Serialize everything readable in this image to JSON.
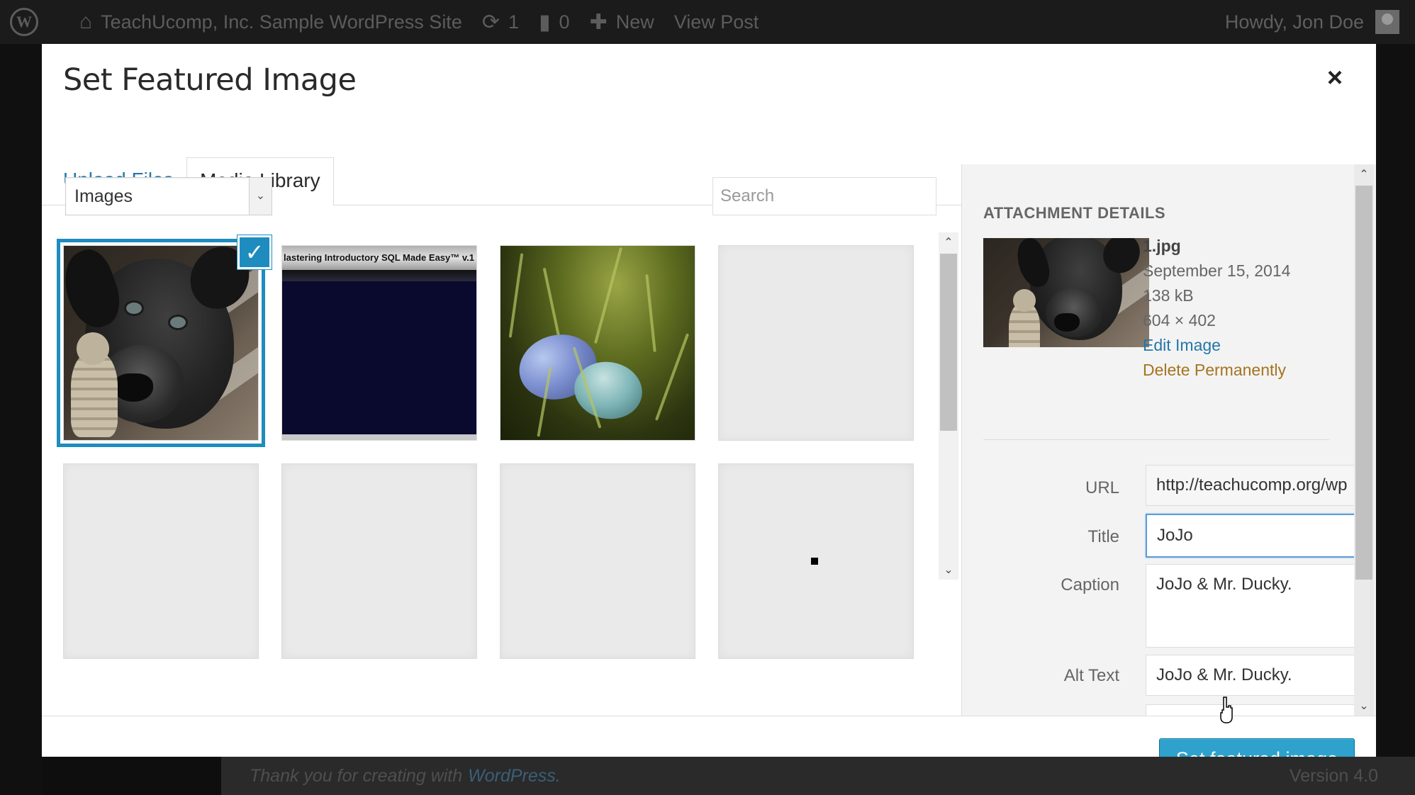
{
  "admin_bar": {
    "site_name": "TeachUcomp, Inc. Sample WordPress Site",
    "updates_count": "1",
    "comments_count": "0",
    "new_label": "New",
    "view_post_label": "View Post",
    "howdy": "Howdy, Jon Doe",
    "icons": [
      "wordpress-logo-icon",
      "home-icon",
      "updates-icon",
      "comment-icon",
      "plus-icon"
    ]
  },
  "modal": {
    "title": "Set Featured Image",
    "close_glyph": "×",
    "tabs": [
      {
        "label": "Upload Files",
        "active": false
      },
      {
        "label": "Media Library",
        "active": true
      }
    ],
    "filter": {
      "selected": "Images",
      "arrow_glyph": "⌄"
    },
    "search": {
      "placeholder": "Search"
    },
    "grid": {
      "items": [
        {
          "name": "dog-photo",
          "selected": true
        },
        {
          "name": "sql-banner",
          "selected": false,
          "caption": "lastering Introductory SQL Made Easy™ v.1"
        },
        {
          "name": "eggs-photo",
          "selected": false
        },
        {
          "name": "blank",
          "selected": false
        },
        {
          "name": "blank",
          "selected": false
        },
        {
          "name": "blank",
          "selected": false
        },
        {
          "name": "blank",
          "selected": false
        },
        {
          "name": "blank",
          "selected": false
        }
      ],
      "check_glyph": "✓"
    },
    "attachment_details": {
      "heading": "ATTACHMENT DETAILS",
      "filename": "1.jpg",
      "date": "September 15, 2014",
      "size": "138 kB",
      "dimensions": "604 × 402",
      "edit_link": "Edit Image",
      "delete_link": "Delete Permanently",
      "fields": {
        "url_label": "URL",
        "url_value": "http://teachucomp.org/wp",
        "title_label": "Title",
        "title_value": "JoJo",
        "caption_label": "Caption",
        "caption_value": "JoJo & Mr. Ducky.",
        "alt_label": "Alt Text",
        "alt_value": "JoJo & Mr. Ducky."
      }
    },
    "primary_button": "Set featured image"
  },
  "background_footer": {
    "thanks_text": "Thank you for creating with",
    "wp_link": "WordPress.",
    "version": "Version 4.0"
  },
  "colors": {
    "accent": "#2ea2cc",
    "link": "#2477aa",
    "delete_link": "#a6741f",
    "selection_outline": "#1e8cbe",
    "admin_bar": "#1b1b1b"
  }
}
